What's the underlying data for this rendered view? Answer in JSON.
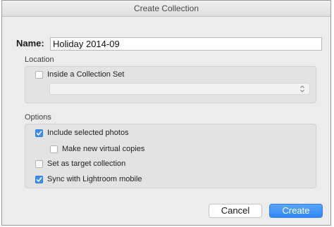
{
  "dialog": {
    "title": "Create Collection",
    "name_label": "Name:",
    "name_value": "Holiday 2014-09"
  },
  "location": {
    "heading": "Location",
    "inside_set": {
      "label": "Inside a Collection Set",
      "checked": false
    },
    "set_select": {
      "value": ""
    }
  },
  "options": {
    "heading": "Options",
    "include_selected": {
      "label": "Include selected photos",
      "checked": true
    },
    "virtual_copies": {
      "label": "Make new virtual copies",
      "checked": false
    },
    "target_collection": {
      "label": "Set as target collection",
      "checked": false
    },
    "sync_mobile": {
      "label": "Sync with Lightroom mobile",
      "checked": true
    }
  },
  "buttons": {
    "cancel": "Cancel",
    "create": "Create"
  },
  "colors": {
    "accent": "#3d8ef0",
    "primary_button": "#2f86f6",
    "dialog_bg": "#ececec"
  },
  "icons": {
    "checkmark": "checkmark-icon",
    "select_arrows": "up-down-chevron-icon"
  }
}
